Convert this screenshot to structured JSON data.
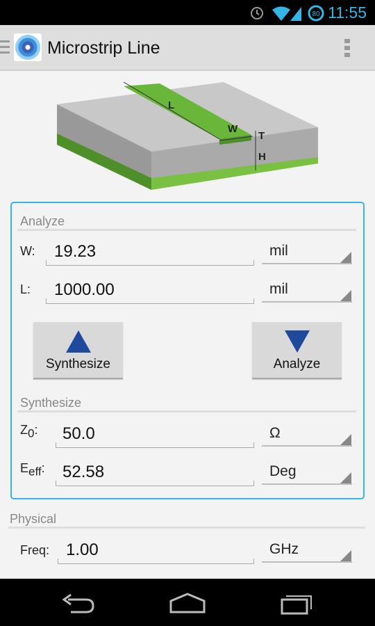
{
  "status_bar": {
    "time": "11:55",
    "battery": "80",
    "icons": [
      "alarm-icon",
      "wifi-icon",
      "signal-icon",
      "battery-icon"
    ]
  },
  "action_bar": {
    "title": "Microstrip Line",
    "menu_icon": "overflow-menu-icon"
  },
  "diagram": {
    "labels": {
      "L": "L",
      "W": "W",
      "T": "T",
      "H": "H"
    }
  },
  "analyze": {
    "header": "Analyze",
    "w": {
      "label": "W:",
      "value": "19.23",
      "unit": "mil"
    },
    "l": {
      "label": "L:",
      "value": "1000.00",
      "unit": "mil"
    }
  },
  "buttons": {
    "synthesize": "Synthesize",
    "analyze": "Analyze"
  },
  "synthesize": {
    "header": "Synthesize",
    "z0": {
      "label": "Z",
      "sub": "0",
      "colon": ":",
      "value": "50.0",
      "unit": "Ω"
    },
    "eeff": {
      "label": "E",
      "sub": "eff",
      "colon": ":",
      "value": "52.58",
      "unit": "Deg"
    }
  },
  "physical": {
    "header": "Physical",
    "freq": {
      "label": "Freq:",
      "value": "1.00",
      "unit": "GHz"
    }
  },
  "colors": {
    "accent": "#33b5e5",
    "button_arrow": "#1f4a9c",
    "board_green": "#6ab63a"
  }
}
